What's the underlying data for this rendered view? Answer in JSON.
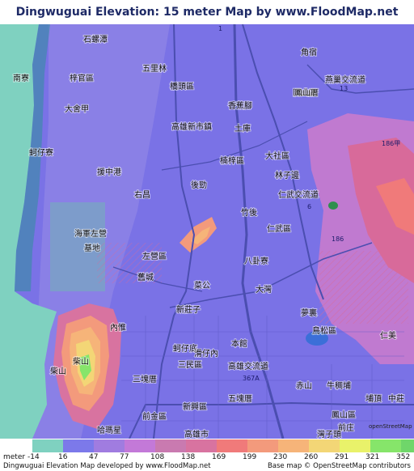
{
  "title": "Dingwuguai Elevation: 15 meter Map by www.FloodMap.net (beta)",
  "legend": {
    "unit_label": "meter",
    "min_label": "-14",
    "thresholds": [
      "16",
      "47",
      "77",
      "108",
      "138",
      "169",
      "199",
      "230",
      "260",
      "291",
      "321",
      "352"
    ],
    "colors": [
      "#7fd1c0",
      "#7c79ea",
      "#a07ce0",
      "#c379d8",
      "#c97ab0",
      "#d873a0",
      "#f07a7a",
      "#f39a7c",
      "#f6b479",
      "#f3d676",
      "#e9f26a",
      "#86e56a",
      "#6fd66a"
    ]
  },
  "footer": {
    "left": "Dingwuguai Elevation Map developed by www.FloodMap.net",
    "right": "Base map © OpenStreetMap contributors"
  },
  "brand": "openStreetMap",
  "places": [
    {
      "id": "shiluoqian",
      "name": "石螺潭"
    },
    {
      "id": "nanliao",
      "name": "南寮"
    },
    {
      "id": "ziguan",
      "name": "梓官區"
    },
    {
      "id": "dashe",
      "name": "大舍甲"
    },
    {
      "id": "dingzijiao",
      "name": "蚵仔寮"
    },
    {
      "id": "wulilin",
      "name": "五里林"
    },
    {
      "id": "qiaotou",
      "name": "橋頭區"
    },
    {
      "id": "gangshan",
      "name": "岡山區"
    },
    {
      "id": "jiaodingshan",
      "name": "角宿"
    },
    {
      "id": "yanchao",
      "name": "燕巢交流道"
    },
    {
      "id": "fengshan",
      "name": "鳳山厝"
    },
    {
      "id": "xiangjiao",
      "name": "香蕉腳"
    },
    {
      "id": "kaohsiungnew",
      "name": "高雄新市鎮"
    },
    {
      "id": "tuku",
      "name": "土庫"
    },
    {
      "id": "dashequ",
      "name": "大社區"
    },
    {
      "id": "linziban",
      "name": "林子邊"
    },
    {
      "id": "nanzihou",
      "name": "楠梓區"
    },
    {
      "id": "zhongzhou",
      "name": "援中港"
    },
    {
      "id": "youchang",
      "name": "右昌"
    },
    {
      "id": "houjin",
      "name": "後勁"
    },
    {
      "id": "renwu",
      "name": "仁武交流道"
    },
    {
      "id": "zhuhou",
      "name": "竹後"
    },
    {
      "id": "renwuqu",
      "name": "仁武區"
    },
    {
      "id": "haijun",
      "name": "海軍左營"
    },
    {
      "id": "jidi",
      "name": "基地"
    },
    {
      "id": "zuoying",
      "name": "左營區"
    },
    {
      "id": "bagua",
      "name": "八卦寮"
    },
    {
      "id": "jiucheng",
      "name": "舊城"
    },
    {
      "id": "caigong",
      "name": "菜公"
    },
    {
      "id": "dawan",
      "name": "大灣"
    },
    {
      "id": "xinzhuangzi",
      "name": "新莊子"
    },
    {
      "id": "mengli",
      "name": "夢裏"
    },
    {
      "id": "neiwei",
      "name": "內惟"
    },
    {
      "id": "niaosong",
      "name": "鳥松區"
    },
    {
      "id": "chaishan",
      "name": "柴山"
    },
    {
      "id": "chaishan2",
      "name": "柴山"
    },
    {
      "id": "zaizidi",
      "name": "蚵仔底"
    },
    {
      "id": "huanian",
      "name": "滑仔內"
    },
    {
      "id": "benguan",
      "name": "本館"
    },
    {
      "id": "renmei",
      "name": "仁美"
    },
    {
      "id": "sanmin",
      "name": "三民區"
    },
    {
      "id": "kaohsiungjiao",
      "name": "高雄交流道"
    },
    {
      "id": "sankuai",
      "name": "三塊厝"
    },
    {
      "id": "chishan",
      "name": "赤山"
    },
    {
      "id": "niuchou",
      "name": "牛稠埔"
    },
    {
      "id": "wukuai",
      "name": "五塊厝"
    },
    {
      "id": "weiding",
      "name": "埔頂"
    },
    {
      "id": "zhongzhuang",
      "name": "中莊"
    },
    {
      "id": "yancheng",
      "name": "新興區"
    },
    {
      "id": "fengshanqu",
      "name": "鳳山區"
    },
    {
      "id": "qianjin",
      "name": "前金區"
    },
    {
      "id": "qianzhuang",
      "name": "前庄"
    },
    {
      "id": "hamaxing",
      "name": "哈瑪星"
    },
    {
      "id": "kaohsiungcity",
      "name": "高雄市"
    },
    {
      "id": "wagongzi",
      "name": "灣子頭"
    }
  ],
  "road_labels": [
    {
      "id": "r1",
      "name": "1"
    },
    {
      "id": "r13",
      "name": "13"
    },
    {
      "id": "r186a",
      "name": "186甲"
    },
    {
      "id": "r186",
      "name": "186"
    },
    {
      "id": "r6",
      "name": "6"
    },
    {
      "id": "r367a",
      "name": "367A"
    }
  ]
}
